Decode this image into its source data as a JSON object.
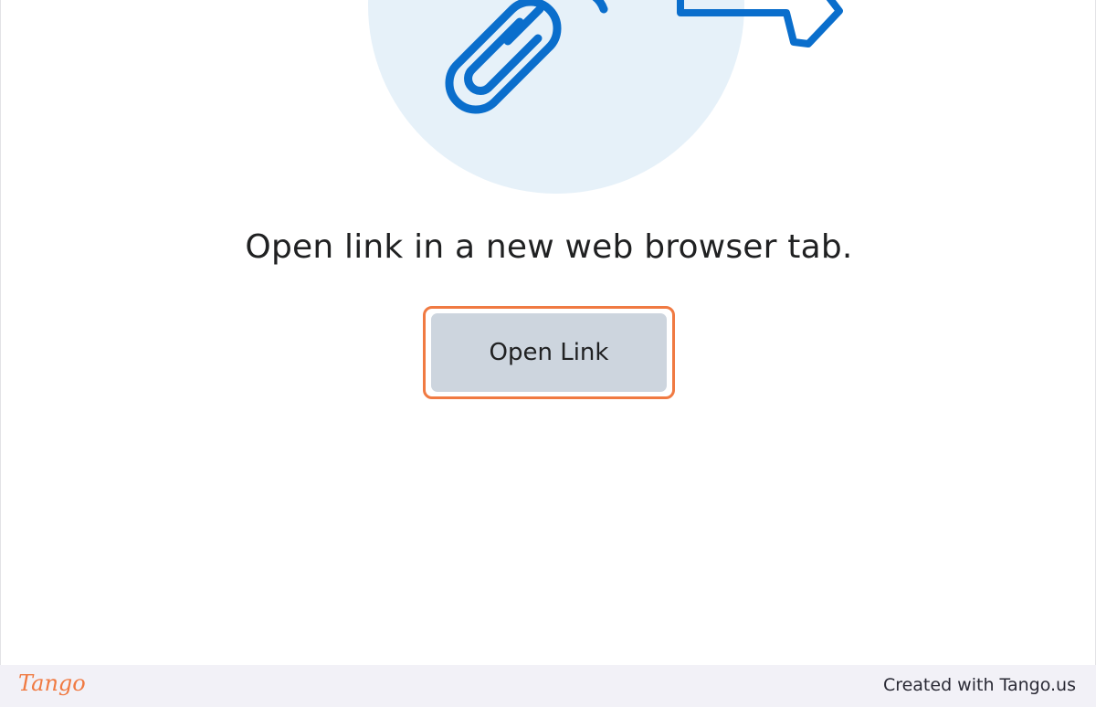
{
  "content": {
    "message": "Open link in a new web browser tab.",
    "button_label": "Open Link"
  },
  "footer": {
    "logo_text": "Tango",
    "credit": "Created with Tango.us"
  },
  "colors": {
    "accent_highlight": "#f07a42",
    "icon_blue": "#0a6ecc",
    "circle_bg": "#e6f1f9",
    "button_bg": "#cdd5de"
  },
  "icons": [
    "link-chain-icon",
    "external-arrow-icon"
  ]
}
